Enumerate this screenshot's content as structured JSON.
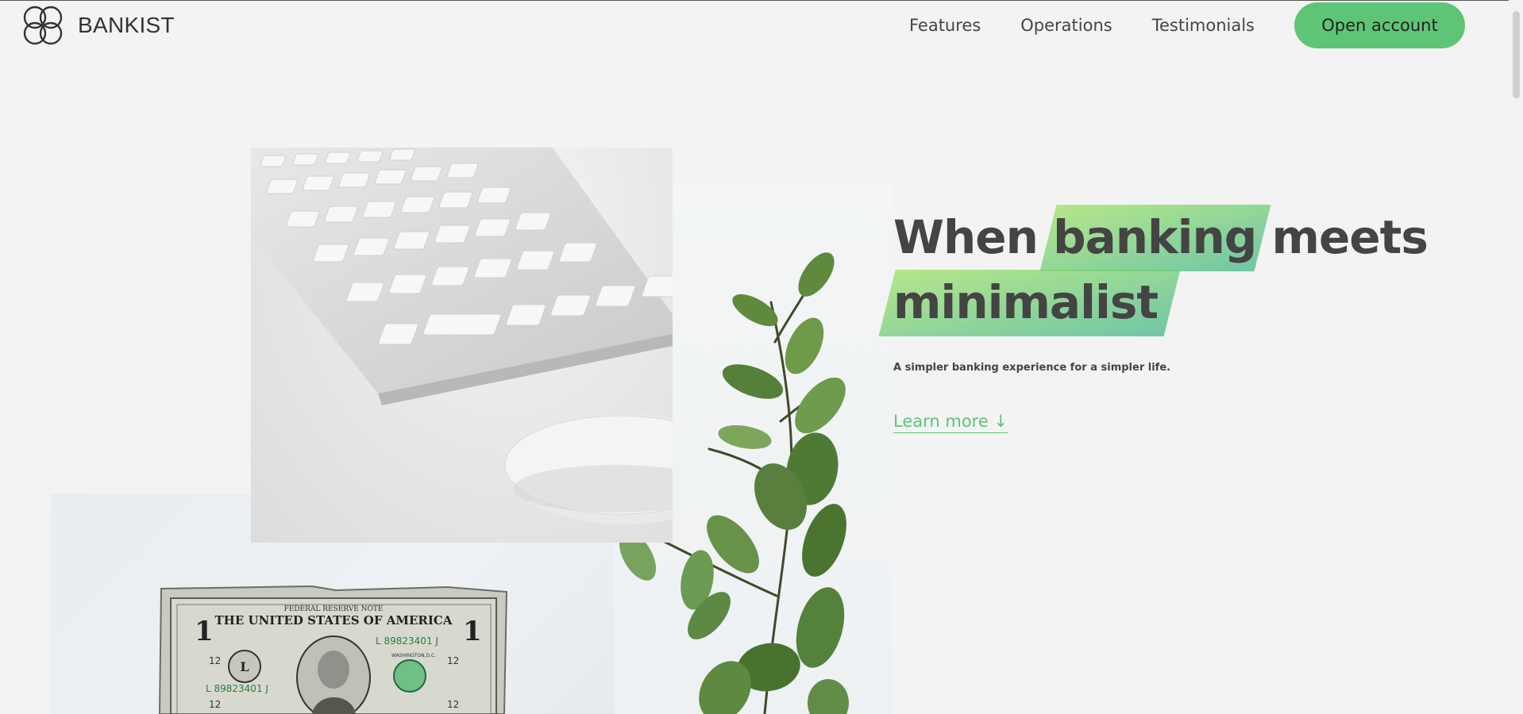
{
  "brand": {
    "logo_icon": "four-circle-logo-icon",
    "name": "BANKIST"
  },
  "nav": {
    "links": [
      {
        "label": "Features"
      },
      {
        "label": "Operations"
      },
      {
        "label": "Testimonials"
      }
    ],
    "cta_label": "Open account"
  },
  "hero": {
    "title_line1_pre": "When",
    "title_line1_highlight": "banking",
    "title_line1_post": "meets",
    "title_line2_highlight": "minimalist",
    "subtitle": "A simpler banking experience for a simpler life.",
    "learn_more_label": "Learn more ↓",
    "images": [
      {
        "name": "keyboard-mouse-image"
      },
      {
        "name": "plant-image"
      },
      {
        "name": "dollar-bill-image"
      }
    ]
  },
  "dollar_bill_texts": {
    "top_banner": "FEDERAL RESERVE NOTE",
    "header": "THE UNITED STATES OF AMERICA",
    "serial": "L 89823401 J",
    "corner_value": "1",
    "side_value": "12",
    "seal_letter": "L",
    "city": "WASHINGTON,D.C."
  },
  "colors": {
    "accent": "#5ec576",
    "highlight_from": "#9be15d",
    "highlight_to": "#39b385",
    "text": "#444444",
    "background": "#f3f3f3"
  }
}
